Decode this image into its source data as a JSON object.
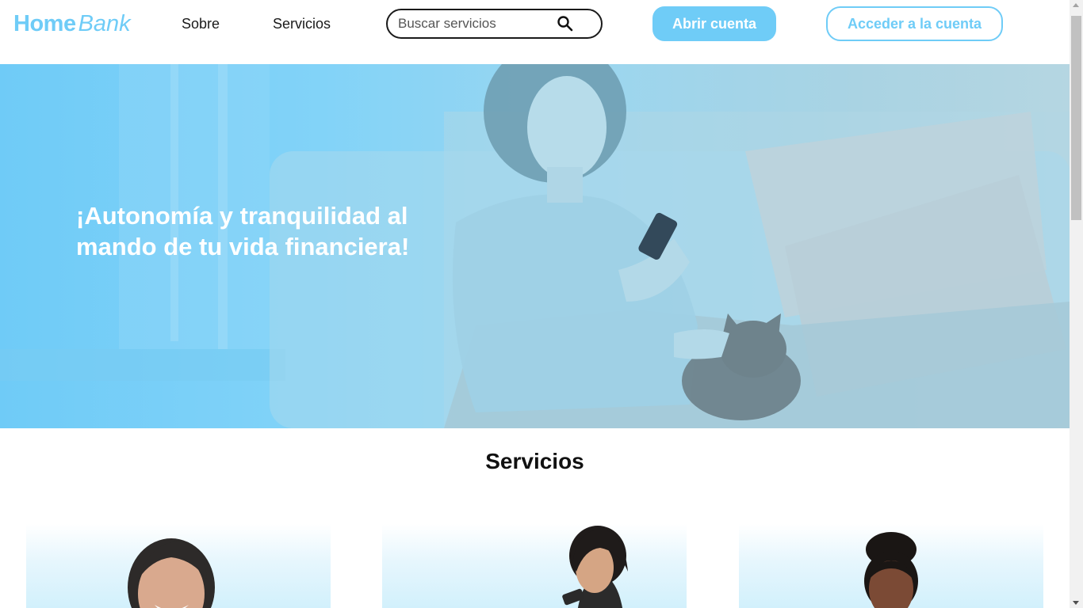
{
  "header": {
    "logo_bold": "Home",
    "logo_italic": "Bank",
    "nav": {
      "sobre": "Sobre",
      "servicios": "Servicios"
    },
    "search": {
      "placeholder": "Buscar servicios",
      "icon": "search-icon"
    },
    "open_account_label": "Abrir cuenta",
    "login_label": "Acceder a la cuenta"
  },
  "hero": {
    "title": "¡Autonomía y tranquilidad al mando de tu vida financiera!"
  },
  "services": {
    "title": "Servicios"
  },
  "colors": {
    "accent": "#6fccf7",
    "text": "#1a1a1a",
    "hero_overlay": "#82d3f8"
  }
}
